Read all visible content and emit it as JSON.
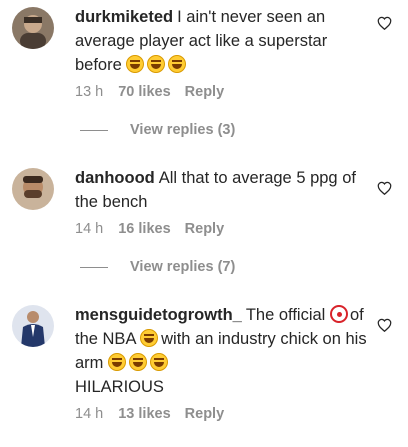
{
  "comments": [
    {
      "username": "durkmiketed",
      "text": "I ain't never seen an average player act like a superstar before",
      "emojis": [
        "face-with-tears-of-joy",
        "face-with-tears-of-joy",
        "face-with-tears-of-joy"
      ],
      "time": "13 h",
      "likes": "70 likes",
      "reply": "Reply",
      "view_replies": "View replies (3)",
      "avatar_color": "#7f6d5b"
    },
    {
      "username": "danhoood",
      "text": "All that to average 5 ppg of the bench",
      "time": "14 h",
      "likes": "16 likes",
      "reply": "Reply",
      "view_replies": "View replies (7)",
      "avatar_color": "#a07c60"
    },
    {
      "username": "mensguidetogrowth_",
      "text_part1": "The official",
      "text_part2": "of the NBA",
      "text_part3": "with an industry chick on his arm",
      "text_part4": "HILARIOUS",
      "time": "14 h",
      "likes": "13 likes",
      "reply": "Reply",
      "avatar_color": "#2b3f6b"
    }
  ],
  "colors": {
    "text": "#262626",
    "secondary": "#8e8e8e"
  },
  "icons": {
    "like": "heart-outline-icon"
  }
}
